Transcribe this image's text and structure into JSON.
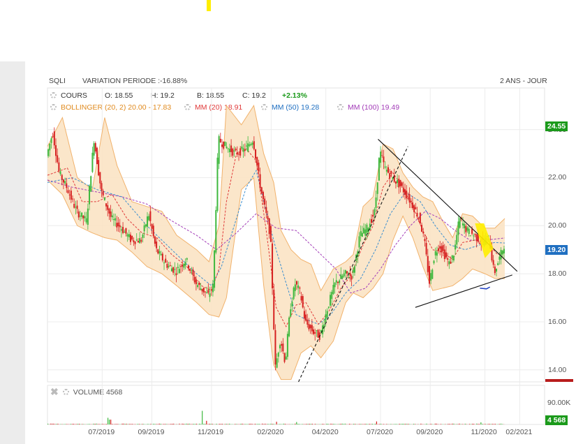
{
  "header": {
    "ticker": "SQLI",
    "variation": "VARIATION PERIODE :-16.88%",
    "period": "2 ANS - JOUR"
  },
  "legend": {
    "cours": {
      "label": "COURS",
      "open": "O: 18.55",
      "high": "H: 19.2",
      "low": "B: 18.55",
      "close": "C: 19.2",
      "change": "+2.13%"
    },
    "bollinger": "BOLLINGER (20, 2) 20.00 - 17.83",
    "mm20": "MM (20) 18.91",
    "mm50": "MM (50) 19.28",
    "mm100": "MM (100) 19.49",
    "volume": "VOLUME  4568"
  },
  "badges": {
    "top_price": "24.55",
    "last_price": "19.20",
    "last_volume": "4 568"
  },
  "colors": {
    "up": "#3db83d",
    "down": "#d62020",
    "bollinger_fill": "#fbe3c4",
    "bollinger_line": "#f1b26c",
    "mm20": "#e03a3a",
    "mm50": "#3a8ed0",
    "mm100": "#a33cb8",
    "badge_green": "#1b9a1b",
    "badge_blue": "#1f6fc1",
    "highlight": "#ffee00"
  },
  "chart_data": {
    "type": "candlestick",
    "period": "2 ANS - JOUR",
    "y_ticks": [
      "24.00",
      "22.00",
      "20.00",
      "18.00",
      "16.00",
      "14.00"
    ],
    "y_tick_values": [
      24,
      22,
      20,
      18,
      16,
      14
    ],
    "ylim": [
      13.5,
      24.6
    ],
    "x_ticks": [
      "07/2019",
      "09/2019",
      "11/2019",
      "02/2020",
      "04/2020",
      "07/2020",
      "09/2020",
      "11/2020",
      "02/2021"
    ],
    "volume_tick": "90.00K",
    "volume_tick_value": 90000,
    "grid": true,
    "price_path": [
      [
        0,
        22.9
      ],
      [
        0.012,
        23.9
      ],
      [
        0.025,
        22.2
      ],
      [
        0.04,
        21.6
      ],
      [
        0.06,
        20.6
      ],
      [
        0.08,
        20.2
      ],
      [
        0.095,
        23.6
      ],
      [
        0.11,
        21.4
      ],
      [
        0.13,
        20.3
      ],
      [
        0.15,
        19.9
      ],
      [
        0.17,
        19.4
      ],
      [
        0.19,
        19.4
      ],
      [
        0.205,
        20.5
      ],
      [
        0.22,
        19.0
      ],
      [
        0.24,
        18.4
      ],
      [
        0.26,
        18.1
      ],
      [
        0.28,
        18.6
      ],
      [
        0.3,
        17.6
      ],
      [
        0.325,
        17.1
      ],
      [
        0.335,
        17.5
      ],
      [
        0.345,
        23.6
      ],
      [
        0.36,
        23.3
      ],
      [
        0.38,
        23.0
      ],
      [
        0.4,
        23.2
      ],
      [
        0.415,
        23.6
      ],
      [
        0.43,
        21.6
      ],
      [
        0.45,
        19.6
      ],
      [
        0.46,
        14.1
      ],
      [
        0.47,
        15.3
      ],
      [
        0.48,
        14.3
      ],
      [
        0.49,
        16.6
      ],
      [
        0.5,
        17.6
      ],
      [
        0.51,
        17.2
      ],
      [
        0.52,
        16.0
      ],
      [
        0.535,
        15.6
      ],
      [
        0.55,
        15.4
      ],
      [
        0.565,
        16.6
      ],
      [
        0.58,
        17.6
      ],
      [
        0.6,
        18.0
      ],
      [
        0.615,
        17.9
      ],
      [
        0.63,
        19.6
      ],
      [
        0.645,
        19.9
      ],
      [
        0.66,
        20.6
      ],
      [
        0.67,
        23.1
      ],
      [
        0.68,
        22.4
      ],
      [
        0.695,
        22.0
      ],
      [
        0.71,
        21.7
      ],
      [
        0.72,
        21.4
      ],
      [
        0.735,
        20.9
      ],
      [
        0.75,
        20.3
      ],
      [
        0.76,
        19.3
      ],
      [
        0.77,
        17.6
      ],
      [
        0.78,
        18.8
      ],
      [
        0.79,
        19.2
      ],
      [
        0.8,
        18.8
      ],
      [
        0.81,
        18.4
      ],
      [
        0.82,
        18.9
      ],
      [
        0.83,
        20.3
      ],
      [
        0.845,
        19.8
      ],
      [
        0.86,
        19.6
      ],
      [
        0.875,
        19.3
      ],
      [
        0.89,
        19.5
      ],
      [
        0.9,
        18.0
      ],
      [
        0.91,
        18.6
      ],
      [
        0.92,
        19.2
      ]
    ],
    "bollinger_upper": [
      [
        0,
        23.3
      ],
      [
        0.03,
        24.5
      ],
      [
        0.06,
        22.0
      ],
      [
        0.09,
        21.5
      ],
      [
        0.115,
        24.5
      ],
      [
        0.14,
        22.5
      ],
      [
        0.17,
        21.0
      ],
      [
        0.2,
        20.8
      ],
      [
        0.23,
        20.6
      ],
      [
        0.26,
        19.6
      ],
      [
        0.3,
        19.0
      ],
      [
        0.325,
        18.5
      ],
      [
        0.345,
        20.0
      ],
      [
        0.36,
        25.0
      ],
      [
        0.39,
        24.2
      ],
      [
        0.415,
        25.0
      ],
      [
        0.435,
        23.0
      ],
      [
        0.455,
        21.8
      ],
      [
        0.47,
        19.8
      ],
      [
        0.49,
        19.0
      ],
      [
        0.51,
        18.6
      ],
      [
        0.53,
        18.4
      ],
      [
        0.55,
        17.3
      ],
      [
        0.575,
        18.2
      ],
      [
        0.6,
        18.5
      ],
      [
        0.615,
        18.8
      ],
      [
        0.635,
        20.8
      ],
      [
        0.655,
        21.2
      ],
      [
        0.675,
        23.4
      ],
      [
        0.695,
        23.2
      ],
      [
        0.715,
        22.2
      ],
      [
        0.735,
        21.6
      ],
      [
        0.755,
        21.2
      ],
      [
        0.775,
        21.0
      ],
      [
        0.795,
        20.2
      ],
      [
        0.815,
        19.5
      ],
      [
        0.835,
        20.5
      ],
      [
        0.855,
        20.4
      ],
      [
        0.88,
        19.9
      ],
      [
        0.9,
        19.9
      ],
      [
        0.92,
        20.3
      ]
    ],
    "bollinger_lower": [
      [
        0,
        21.9
      ],
      [
        0.03,
        21.3
      ],
      [
        0.06,
        20.0
      ],
      [
        0.09,
        19.7
      ],
      [
        0.115,
        19.5
      ],
      [
        0.14,
        19.4
      ],
      [
        0.17,
        18.9
      ],
      [
        0.2,
        18.3
      ],
      [
        0.23,
        18.0
      ],
      [
        0.26,
        17.5
      ],
      [
        0.3,
        16.8
      ],
      [
        0.325,
        16.3
      ],
      [
        0.345,
        16.2
      ],
      [
        0.36,
        17.0
      ],
      [
        0.39,
        21.5
      ],
      [
        0.415,
        22.0
      ],
      [
        0.435,
        17.5
      ],
      [
        0.455,
        14.2
      ],
      [
        0.47,
        13.6
      ],
      [
        0.49,
        13.6
      ],
      [
        0.51,
        14.7
      ],
      [
        0.53,
        15.0
      ],
      [
        0.55,
        14.5
      ],
      [
        0.575,
        15.2
      ],
      [
        0.6,
        16.8
      ],
      [
        0.615,
        17.2
      ],
      [
        0.635,
        17.0
      ],
      [
        0.655,
        17.4
      ],
      [
        0.675,
        18.0
      ],
      [
        0.695,
        19.4
      ],
      [
        0.715,
        20.4
      ],
      [
        0.735,
        19.5
      ],
      [
        0.755,
        18.3
      ],
      [
        0.775,
        17.3
      ],
      [
        0.795,
        17.4
      ],
      [
        0.815,
        17.5
      ],
      [
        0.835,
        17.8
      ],
      [
        0.855,
        18.2
      ],
      [
        0.88,
        18.0
      ],
      [
        0.9,
        17.8
      ],
      [
        0.92,
        17.8
      ]
    ],
    "mm20": [
      [
        0,
        22.1
      ],
      [
        0.04,
        22.4
      ],
      [
        0.07,
        21.0
      ],
      [
        0.1,
        21.0
      ],
      [
        0.13,
        21.3
      ],
      [
        0.16,
        20.3
      ],
      [
        0.19,
        19.7
      ],
      [
        0.22,
        19.5
      ],
      [
        0.25,
        18.8
      ],
      [
        0.28,
        18.3
      ],
      [
        0.31,
        17.5
      ],
      [
        0.33,
        17.3
      ],
      [
        0.345,
        18.2
      ],
      [
        0.36,
        21.0
      ],
      [
        0.38,
        23.0
      ],
      [
        0.4,
        23.2
      ],
      [
        0.42,
        22.7
      ],
      [
        0.44,
        19.8
      ],
      [
        0.46,
        16.6
      ],
      [
        0.48,
        15.8
      ],
      [
        0.5,
        16.7
      ],
      [
        0.52,
        16.8
      ],
      [
        0.545,
        15.9
      ],
      [
        0.565,
        16.4
      ],
      [
        0.59,
        17.4
      ],
      [
        0.61,
        17.9
      ],
      [
        0.635,
        19.2
      ],
      [
        0.655,
        20.0
      ],
      [
        0.675,
        21.6
      ],
      [
        0.695,
        22.2
      ],
      [
        0.715,
        21.6
      ],
      [
        0.735,
        20.8
      ],
      [
        0.755,
        19.8
      ],
      [
        0.775,
        19.0
      ],
      [
        0.795,
        18.9
      ],
      [
        0.815,
        18.6
      ],
      [
        0.835,
        19.3
      ],
      [
        0.86,
        19.4
      ],
      [
        0.885,
        19.3
      ],
      [
        0.905,
        18.8
      ],
      [
        0.92,
        18.91
      ]
    ],
    "mm50": [
      [
        0,
        21.8
      ],
      [
        0.05,
        22.0
      ],
      [
        0.1,
        21.5
      ],
      [
        0.15,
        21.2
      ],
      [
        0.2,
        20.0
      ],
      [
        0.25,
        19.0
      ],
      [
        0.3,
        18.0
      ],
      [
        0.33,
        17.5
      ],
      [
        0.35,
        18.3
      ],
      [
        0.38,
        20.3
      ],
      [
        0.4,
        21.6
      ],
      [
        0.42,
        22.3
      ],
      [
        0.44,
        20.6
      ],
      [
        0.46,
        19.0
      ],
      [
        0.48,
        17.6
      ],
      [
        0.5,
        16.3
      ],
      [
        0.52,
        16.1
      ],
      [
        0.545,
        15.9
      ],
      [
        0.57,
        16.3
      ],
      [
        0.6,
        17.2
      ],
      [
        0.63,
        17.8
      ],
      [
        0.66,
        19.0
      ],
      [
        0.69,
        20.5
      ],
      [
        0.72,
        21.4
      ],
      [
        0.75,
        21.0
      ],
      [
        0.78,
        20.0
      ],
      [
        0.81,
        19.2
      ],
      [
        0.84,
        19.0
      ],
      [
        0.87,
        19.2
      ],
      [
        0.9,
        19.3
      ],
      [
        0.92,
        19.28
      ]
    ],
    "mm100": [
      [
        0,
        21.9
      ],
      [
        0.05,
        21.6
      ],
      [
        0.1,
        21.4
      ],
      [
        0.15,
        21.2
      ],
      [
        0.2,
        20.9
      ],
      [
        0.25,
        20.2
      ],
      [
        0.3,
        19.6
      ],
      [
        0.34,
        19.0
      ],
      [
        0.38,
        19.7
      ],
      [
        0.42,
        20.5
      ],
      [
        0.46,
        19.9
      ],
      [
        0.5,
        19.8
      ],
      [
        0.54,
        19.0
      ],
      [
        0.58,
        18.2
      ],
      [
        0.61,
        17.2
      ],
      [
        0.64,
        17.4
      ],
      [
        0.67,
        18.2
      ],
      [
        0.7,
        19.2
      ],
      [
        0.73,
        20.0
      ],
      [
        0.76,
        20.6
      ],
      [
        0.79,
        20.3
      ],
      [
        0.82,
        19.8
      ],
      [
        0.85,
        19.4
      ],
      [
        0.88,
        19.4
      ],
      [
        0.92,
        19.49
      ]
    ],
    "trendlines": [
      {
        "style": "solid",
        "from": [
          0.665,
          23.6
        ],
        "to": [
          0.945,
          18.1
        ]
      },
      {
        "style": "solid",
        "from": [
          0.74,
          16.6
        ],
        "to": [
          0.935,
          17.95
        ]
      },
      {
        "style": "dashed",
        "from": [
          0.505,
          13.5
        ],
        "to": [
          0.725,
          23.3
        ]
      }
    ],
    "annotations": [
      {
        "type": "highlight",
        "shape": "parallelogram",
        "points": [
          [
            0.86,
            20.1
          ],
          [
            0.878,
            20.1
          ],
          [
            0.897,
            19.05
          ],
          [
            0.88,
            18.65
          ]
        ]
      },
      {
        "type": "stroke",
        "points": [
          [
            0.87,
            17.4
          ],
          [
            0.883,
            17.37
          ],
          [
            0.89,
            17.45
          ]
        ]
      }
    ],
    "volume": {
      "max": 90000,
      "last": 4568,
      "spikes": [
        [
          0.12,
          22000
        ],
        [
          0.125,
          16000
        ],
        [
          0.31,
          45000
        ],
        [
          0.32,
          12000
        ],
        [
          0.46,
          9000
        ],
        [
          0.5,
          8000
        ],
        [
          0.66,
          10000
        ],
        [
          0.87,
          7000
        ]
      ]
    }
  }
}
